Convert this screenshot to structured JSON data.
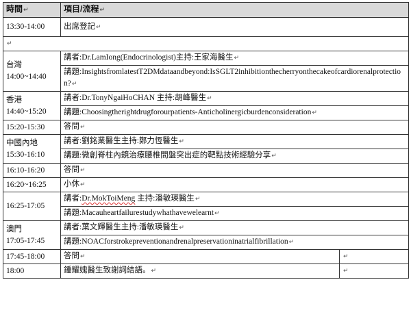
{
  "header": {
    "time": "時間",
    "item": "項目/流程"
  },
  "para_mark": "↵",
  "rows": {
    "r1": {
      "time": "13:30-14:00",
      "item": "出席登記"
    },
    "taiwan": {
      "region": "台灣",
      "time": "14:00~14:40",
      "speaker": "講者:Dr.LamIong(Endocrinologist)主持:王家海醫生",
      "topic": "講題:InsightsfromlatestT2DMdataandbeyond:IsSGLT2inhibitionthecherryonthecakeofcardiorenalprotection?"
    },
    "hongkong": {
      "region": "香港",
      "time": "14:40~15:20",
      "speaker": "講者:Dr.TonyNgaiHoCHAN 主持:胡峰醫生",
      "topic": "講題:Choosingtherightdrugforourpatients-Anticholinergicburdenconsideration"
    },
    "r4": {
      "time": "15:20-15:30",
      "item": "答問"
    },
    "mainland": {
      "region": "中國內地",
      "time": "15:30-16:10",
      "speaker": "講者:劉銘業醫生主持:鄭力恆醫生",
      "topic": "講題:微創脊柱內鏡治療腰椎間盤突出症的靶點技術經驗分享"
    },
    "r6": {
      "time": "16:10-16:20",
      "item": "答問"
    },
    "r7": {
      "time": "16:20~16:25",
      "item": "小休"
    },
    "r8": {
      "time": "16:25-17:05",
      "speaker_prefix": "講者:",
      "speaker_name": "Dr.MokToiMeng",
      "speaker_suffix": " 主持:潘敏瑛醫生",
      "topic": "講題:Macauheartfailurestudywhathavewelearnt"
    },
    "macau": {
      "region": "澳門",
      "time": "17:05-17:45",
      "speaker": "講者:葉文輝醫生主持:潘敏瑛醫生",
      "topic": "講題:NOACforstrokepreventionandrenalpreservationinatrialfibrillation"
    },
    "r10": {
      "time": "17:45-18:00",
      "item": "答問"
    },
    "r11": {
      "time": "18:00",
      "item": "鍾耀媿醫生致謝詞結語。"
    }
  }
}
